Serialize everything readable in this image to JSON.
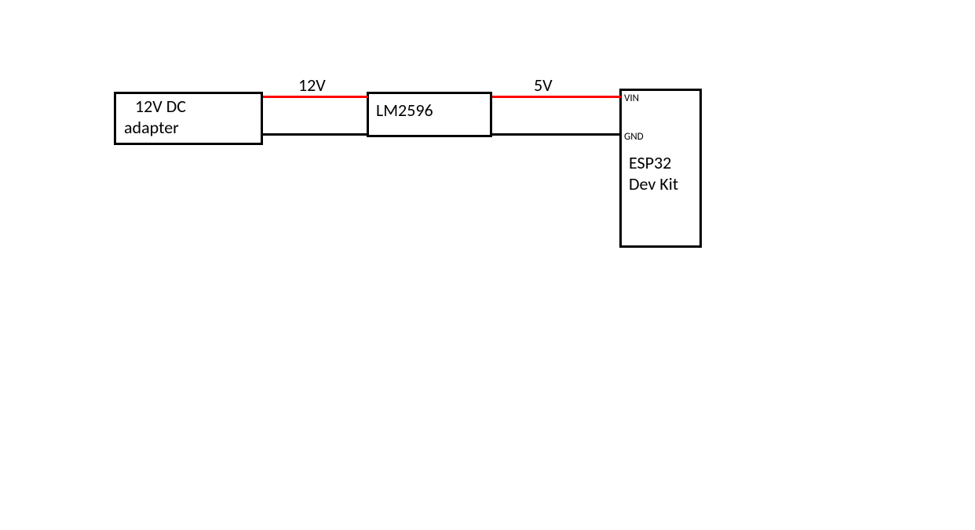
{
  "blocks": {
    "adapter": {
      "line1": "12V DC",
      "line2": "adapter"
    },
    "regulator": {
      "name": "LM2596"
    },
    "mcu": {
      "name_line1": "ESP32",
      "name_line2": "Dev Kit",
      "pin_vin": "VIN",
      "pin_gnd": "GND"
    }
  },
  "wires": {
    "v_in": "12V",
    "v_out": "5V"
  },
  "colors": {
    "power": "#ff0000",
    "ground": "#000000",
    "box_border": "#000000"
  }
}
